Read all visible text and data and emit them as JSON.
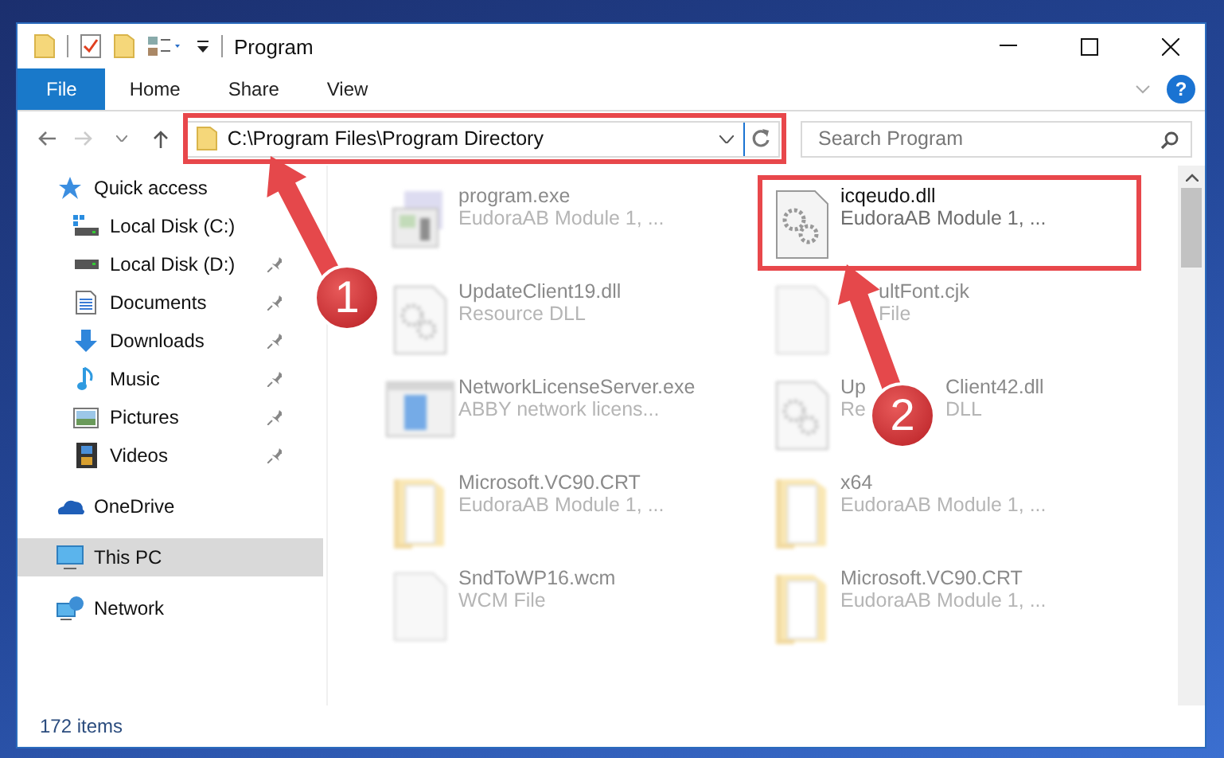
{
  "window": {
    "title": "Program"
  },
  "ribbon": {
    "tabs": [
      {
        "label": "File",
        "selected": true
      },
      {
        "label": "Home",
        "selected": false
      },
      {
        "label": "Share",
        "selected": false
      },
      {
        "label": "View",
        "selected": false
      }
    ],
    "help": "?"
  },
  "address": {
    "path": "C:\\Program Files\\Program Directory"
  },
  "search": {
    "placeholder": "Search Program"
  },
  "sidebar": {
    "items": [
      {
        "label": "Quick access",
        "kind": "star",
        "selected": false,
        "children": [
          {
            "label": "Local Disk (C:)",
            "kind": "system-drive",
            "pinned": false
          },
          {
            "label": "Local Disk (D:)",
            "kind": "drive",
            "pinned": true
          },
          {
            "label": "Documents",
            "kind": "documents",
            "pinned": true
          },
          {
            "label": "Downloads",
            "kind": "downloads",
            "pinned": true
          },
          {
            "label": "Music",
            "kind": "music",
            "pinned": true
          },
          {
            "label": "Pictures",
            "kind": "pictures",
            "pinned": true
          },
          {
            "label": "Videos",
            "kind": "videos",
            "pinned": true
          }
        ]
      },
      {
        "label": "OneDrive",
        "kind": "cloud",
        "selected": false
      },
      {
        "label": "This PC",
        "kind": "computer",
        "selected": true
      },
      {
        "label": "Network",
        "kind": "network",
        "selected": false
      }
    ]
  },
  "files": [
    {
      "name": "program.exe",
      "detail": "EudoraAB Module 1, ...",
      "kind": "app",
      "blurred": true
    },
    {
      "name": "icqeudo.dll",
      "detail": "EudoraAB Module 1, ...",
      "kind": "dll",
      "blurred": false
    },
    {
      "name": "UpdateClient19.dll",
      "detail": "Resource DLL",
      "kind": "dll",
      "blurred": true
    },
    {
      "name": "ultFont.cjk",
      "detail": "File",
      "kind": "file",
      "blurred": true
    },
    {
      "name": "NetworkLicenseServer.exe",
      "detail": "ABBY network licens...",
      "kind": "window",
      "blurred": true
    },
    {
      "name": [
        "Up",
        "Client42.dll"
      ],
      "detail": [
        "Re",
        "DLL"
      ],
      "kind": "dll",
      "blurred": true
    },
    {
      "name": "Microsoft.VC90.CRT",
      "detail": "EudoraAB Module 1, ...",
      "kind": "folder",
      "blurred": true
    },
    {
      "name": "x64",
      "detail": "EudoraAB Module 1, ...",
      "kind": "folder",
      "blurred": true
    },
    {
      "name": "SndToWP16.wcm",
      "detail": "WCM File",
      "kind": "file",
      "blurred": true
    },
    {
      "name": "Microsoft.VC90.CRT",
      "detail": "EudoraAB Module 1, ...",
      "kind": "folder",
      "blurred": true
    }
  ],
  "status_bar": {
    "count": "172 items"
  },
  "annotations": [
    {
      "number": "1"
    },
    {
      "number": "2"
    }
  ]
}
